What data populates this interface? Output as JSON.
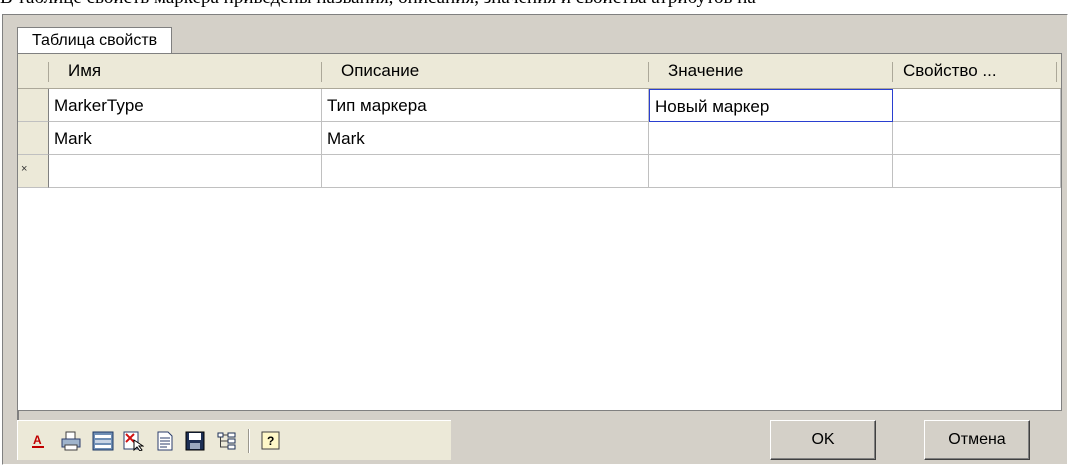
{
  "page_text": "В таблице свойств маркера приведены названия, описания, значения и свойства атрибутов на",
  "tab": {
    "label": "Таблица свойств"
  },
  "grid": {
    "columns": [
      "Имя",
      "Описание",
      "Значение",
      "Свойство ..."
    ],
    "rows": [
      {
        "name": "MarkerType",
        "description": "Тип маркера",
        "value": "Новый маркер",
        "property": ""
      },
      {
        "name": "Mark",
        "description": "Mark",
        "value": "",
        "property": ""
      }
    ],
    "new_row_marker": "×"
  },
  "toolbar": {
    "icons": [
      "font-color-icon",
      "print-icon",
      "table-view-icon",
      "delete-selection-icon",
      "document-icon",
      "save-icon",
      "tree-structure-icon",
      "help-icon"
    ]
  },
  "buttons": {
    "ok": "OK",
    "cancel": "Отмена"
  }
}
